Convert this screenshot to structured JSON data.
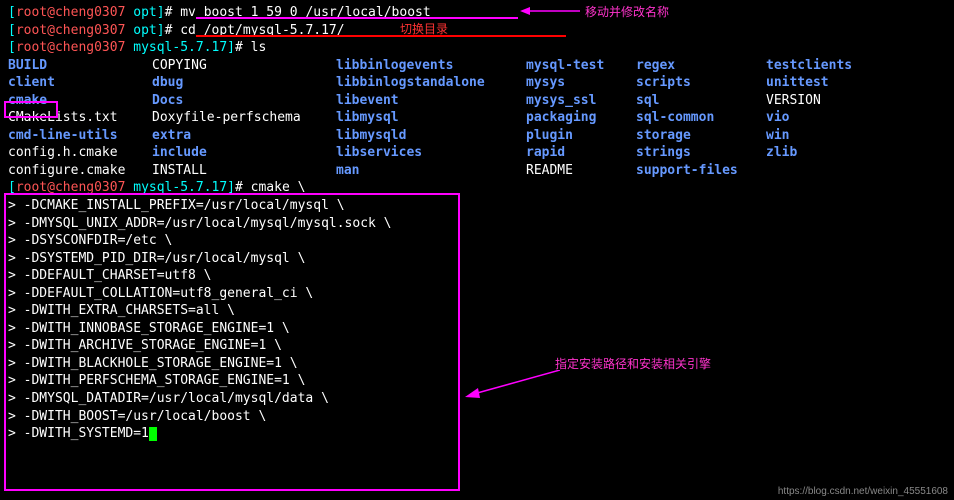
{
  "prompt": {
    "open": "[",
    "user": "root",
    "at": "@",
    "host": "cheng0307",
    "close": "]",
    "symbol": "#"
  },
  "lines": {
    "l1": {
      "path": "opt",
      "cmd": "mv boost 1 59 0 /usr/local/boost"
    },
    "l2": {
      "path": "opt",
      "cmd": "cd /opt/mysql-5.7.17/"
    },
    "l3": {
      "path": "mysql-5.7.17",
      "cmd": "ls"
    }
  },
  "ls": [
    [
      "BUILD",
      "COPYING",
      "libbinlogevents",
      "mysql-test",
      "regex",
      "testclients"
    ],
    [
      "client",
      "dbug",
      "libbinlogstandalone",
      "mysys",
      "scripts",
      "unittest"
    ],
    [
      "cmake",
      "Docs",
      "libevent",
      "mysys_ssl",
      "sql",
      "VERSION"
    ],
    [
      "CMakeLists.txt",
      "Doxyfile-perfschema",
      "libmysql",
      "packaging",
      "sql-common",
      "vio"
    ],
    [
      "cmd-line-utils",
      "extra",
      "libmysqld",
      "plugin",
      "storage",
      "win"
    ],
    [
      "config.h.cmake",
      "include",
      "libservices",
      "rapid",
      "strings",
      "zlib"
    ],
    [
      "configure.cmake",
      "INSTALL",
      "man",
      "README",
      "support-files",
      ""
    ]
  ],
  "ls_plain": [
    "CMakeLists.txt",
    "config.h.cmake",
    "configure.cmake",
    "COPYING",
    "Doxyfile-perfschema",
    "INSTALL",
    "README",
    "VERSION"
  ],
  "cmake_prompt": {
    "path": "mysql-5.7.17",
    "cmd": "cmake \\"
  },
  "cmake_lines": [
    "-DCMAKE_INSTALL_PREFIX=/usr/local/mysql \\",
    "-DMYSQL_UNIX_ADDR=/usr/local/mysql/mysql.sock \\",
    "-DSYSCONFDIR=/etc \\",
    "-DSYSTEMD_PID_DIR=/usr/local/mysql \\",
    "-DDEFAULT_CHARSET=utf8 \\",
    "-DDEFAULT_COLLATION=utf8_general_ci \\",
    "-DWITH_EXTRA_CHARSETS=all \\",
    "-DWITH_INNOBASE_STORAGE_ENGINE=1 \\",
    "-DWITH_ARCHIVE_STORAGE_ENGINE=1 \\",
    "-DWITH_BLACKHOLE_STORAGE_ENGINE=1 \\",
    "-DWITH_PERFSCHEMA_STORAGE_ENGINE=1 \\",
    "-DMYSQL_DATADIR=/usr/local/mysql/data \\",
    "-DWITH_BOOST=/usr/local/boost \\",
    "-DWITH_SYSTEMD=1"
  ],
  "continuation": "> ",
  "annotations": {
    "a1": "移动并修改名称",
    "a2": "切换目录",
    "a3": "指定安装路径和安装相关引擎"
  },
  "watermark": "https://blog.csdn.net/weixin_45551608"
}
